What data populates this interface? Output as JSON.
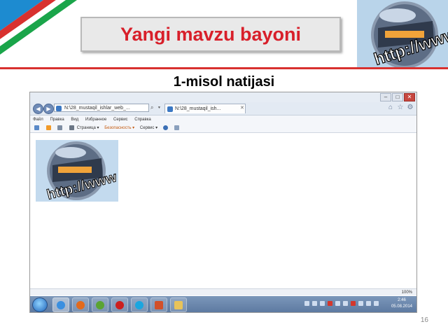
{
  "slide": {
    "title": "Yangi mavzu bayoni",
    "subtitle": "1-misol natijasi",
    "slide_number": "16",
    "logo_text": "http://www"
  },
  "browser": {
    "address": "N:\\28_mustaqil_ishlar_web_...",
    "tab_title": "N:\\28_mustaqil_ish...",
    "address_tools": "⌕ ▾ ⟳ ✕",
    "menu": [
      "Файл",
      "Правка",
      "Вид",
      "Избранное",
      "Сервис",
      "Справка"
    ],
    "commands": {
      "page": "Страница ▾",
      "safety": "Безопасность ▾",
      "tools": "Сервис ▾"
    },
    "zoom": "100%",
    "clock_time": "2:46",
    "clock_date": "05.08.2014"
  },
  "colors": {
    "title_red": "#d81f2a",
    "flag_blue": "#1d8bd0",
    "flag_green": "#1aa54a",
    "rule_red": "#d8312f"
  }
}
